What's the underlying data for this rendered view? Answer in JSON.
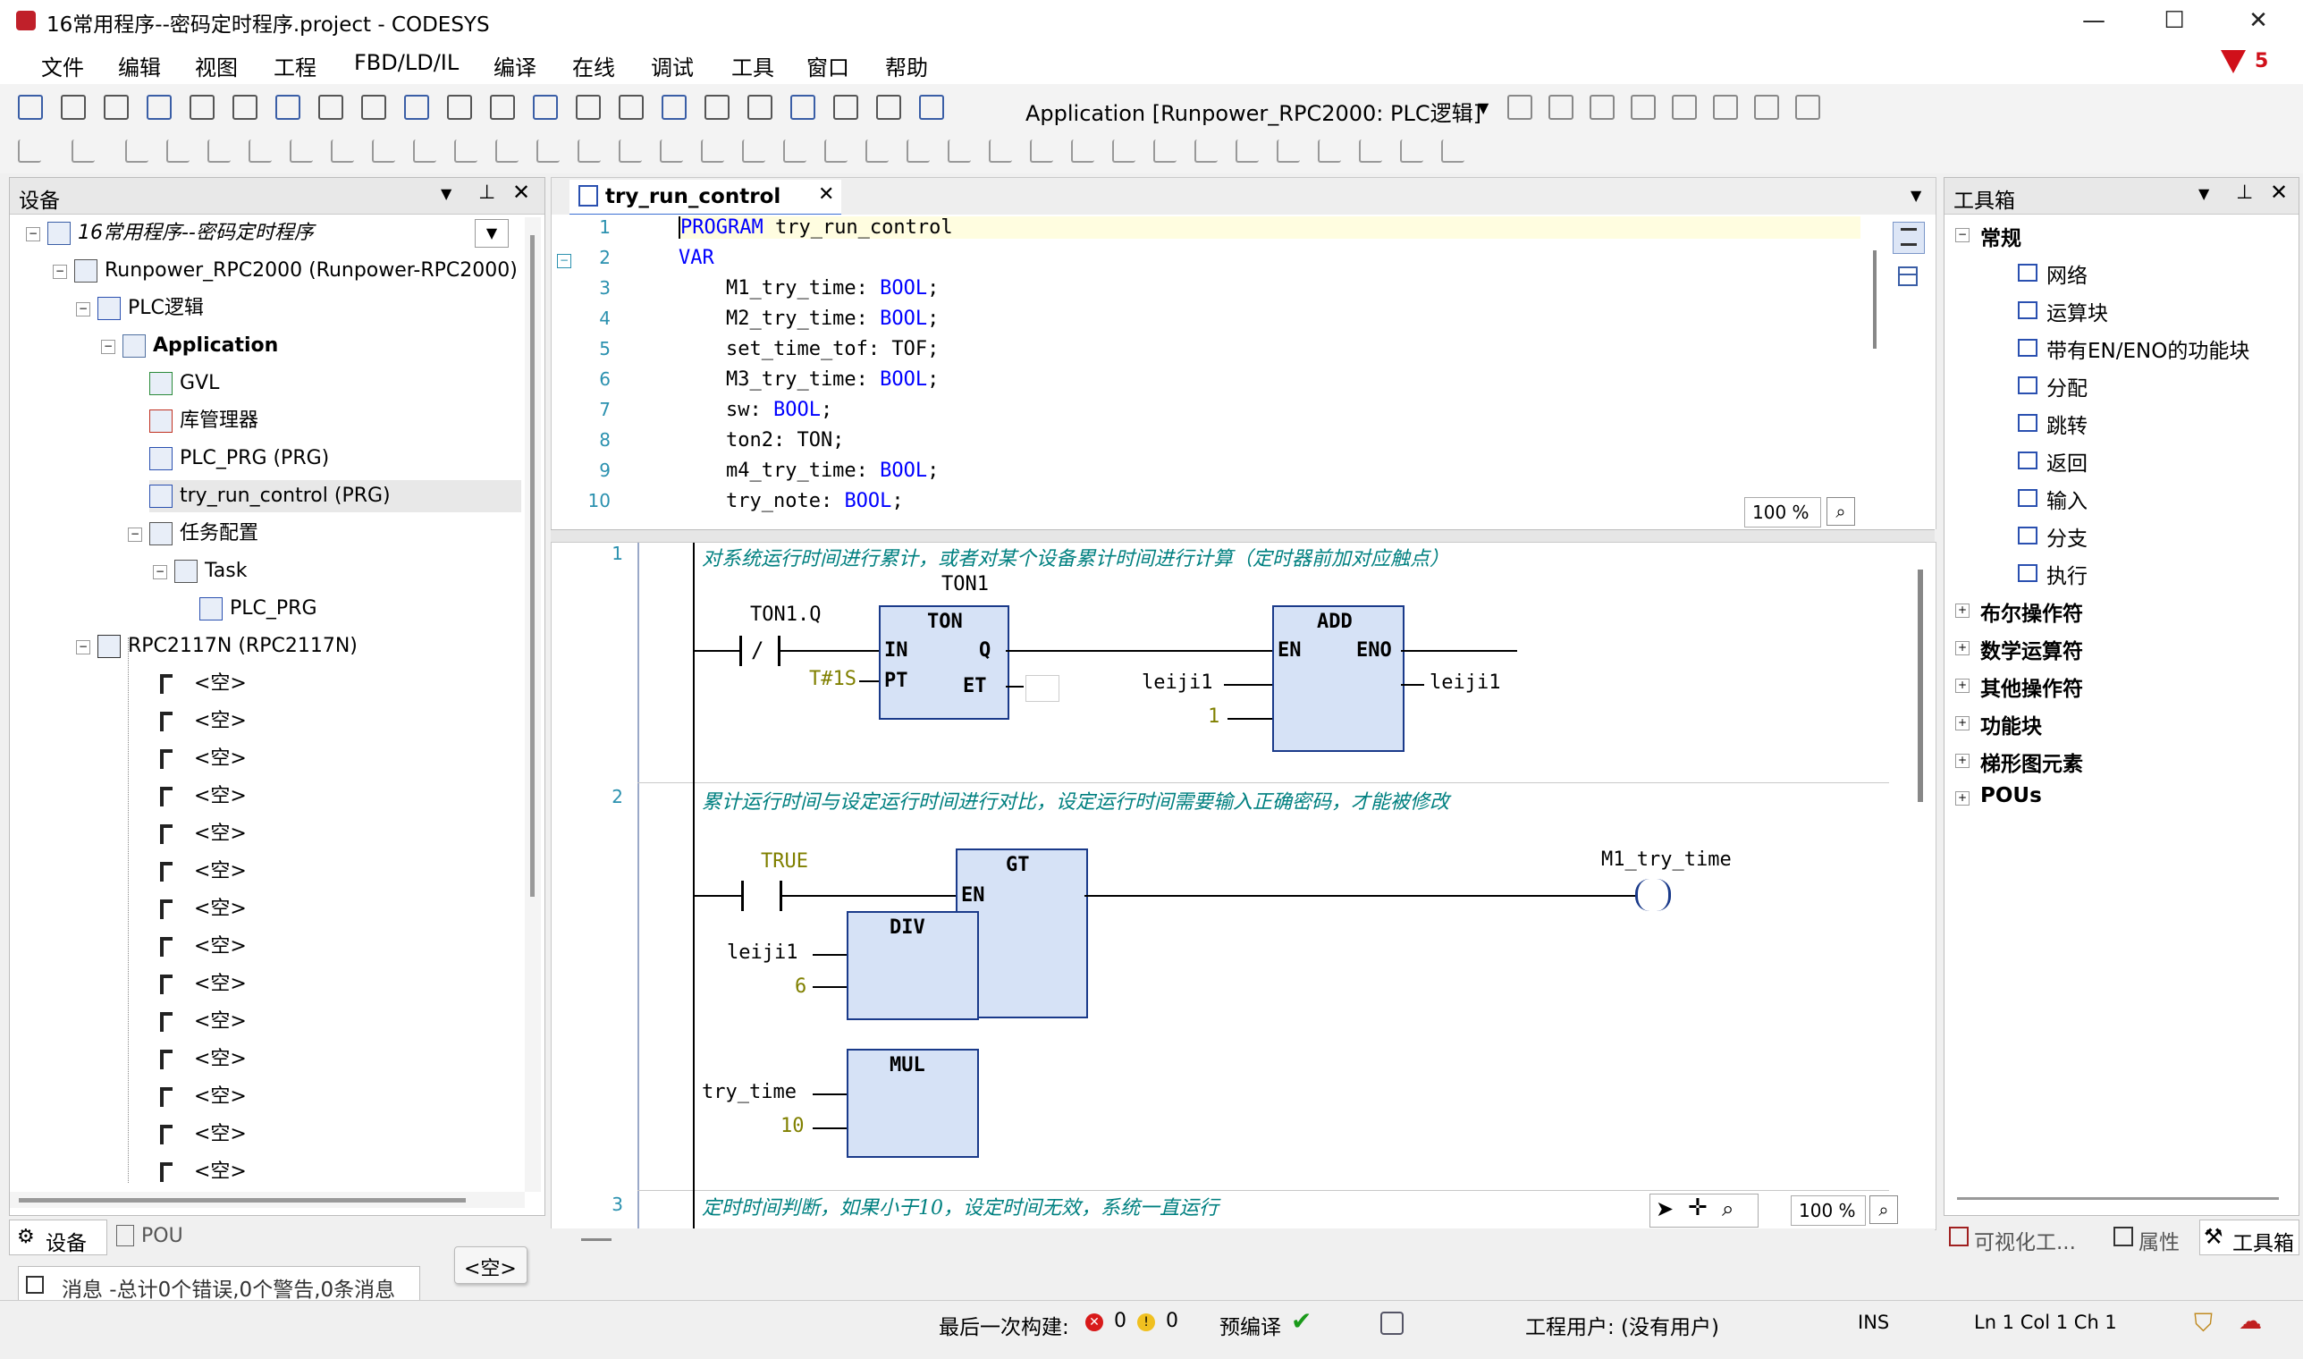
{
  "window": {
    "title": "16常用程序--密码定时程序.project - CODESYS",
    "minimize": "—",
    "maximize": "☐",
    "close": "✕"
  },
  "menu": [
    "文件",
    "编辑",
    "视图",
    "工程",
    "FBD/LD/IL",
    "编译",
    "在线",
    "调试",
    "工具",
    "窗口",
    "帮助"
  ],
  "errors_badge": "5",
  "toolbar": {
    "app_selector": "Application [Runpower_RPC2000: PLC逻辑]"
  },
  "devices_panel": {
    "title": "设备",
    "tree": [
      {
        "label": "16常用程序--密码定时程序",
        "level": 0
      },
      {
        "label": "Runpower_RPC2000 (Runpower-RPC2000)",
        "level": 1
      },
      {
        "label": "PLC逻辑",
        "level": 2
      },
      {
        "label": "Application",
        "level": 3
      },
      {
        "label": "GVL",
        "level": 4
      },
      {
        "label": "库管理器",
        "level": 4
      },
      {
        "label": "PLC_PRG (PRG)",
        "level": 4
      },
      {
        "label": "try_run_control (PRG)",
        "level": 4
      },
      {
        "label": "任务配置",
        "level": 4
      },
      {
        "label": "Task",
        "level": 5
      },
      {
        "label": "PLC_PRG",
        "level": 6
      },
      {
        "label": "RPC2117N (RPC2117N)",
        "level": 2
      }
    ],
    "empty_slot": "<空>",
    "empty_count": 14,
    "tabs": [
      "设备",
      "POU"
    ]
  },
  "editor": {
    "tab": "try_run_control",
    "decl": [
      {
        "n": "1",
        "code": "PROGRAM try_run_control"
      },
      {
        "n": "2",
        "code": "VAR"
      },
      {
        "n": "3",
        "code": "    M1_try_time: BOOL;"
      },
      {
        "n": "4",
        "code": "    M2_try_time: BOOL;"
      },
      {
        "n": "5",
        "code": "    set_time_tof: TOF;"
      },
      {
        "n": "6",
        "code": "    M3_try_time: BOOL;"
      },
      {
        "n": "7",
        "code": "    sw: BOOL;"
      },
      {
        "n": "8",
        "code": "    ton2: TON;"
      },
      {
        "n": "9",
        "code": "    m4_try_time: BOOL;"
      },
      {
        "n": "10",
        "code": "    try_note: BOOL;"
      }
    ],
    "zoom": "100 %",
    "networks": [
      {
        "n": "1",
        "comment": "对系统运行时间进行累计，或者对某个设备累计时间进行计算（定时器前加对应触点）"
      },
      {
        "n": "2",
        "comment": "累计运行时间与设定运行时间进行对比，设定运行时间需要输入正确密码，才能被修改"
      },
      {
        "n": "3",
        "comment": "定时时间判断，如果小于10，设定时间无效，系统一直运行"
      }
    ],
    "net1": {
      "ton_instance": "TON1",
      "ton_title": "TON",
      "in": "IN",
      "pt": "PT",
      "q": "Q",
      "et": "ET",
      "contact": "TON1.Q",
      "pt_val": "T#1S",
      "add_title": "ADD",
      "en": "EN",
      "eno": "ENO",
      "in_var": "leiji1",
      "in_const": "1",
      "out_var": "leiji1"
    },
    "net2": {
      "contact": "TRUE",
      "gt_title": "GT",
      "en": "EN",
      "div_title": "DIV",
      "mul_title": "MUL",
      "div_var": "leiji1",
      "div_const": "6",
      "mul_var": "try_time",
      "mul_const": "10",
      "coil": "M1_try_time"
    }
  },
  "toolbox": {
    "title": "工具箱",
    "groups": [
      {
        "label": "常规",
        "expanded": true,
        "items": [
          "网络",
          "运算块",
          "带有EN/ENO的功能块",
          "分配",
          "跳转",
          "返回",
          "输入",
          "分支",
          "执行"
        ]
      },
      {
        "label": "布尔操作符"
      },
      {
        "label": "数学运算符"
      },
      {
        "label": "其他操作符"
      },
      {
        "label": "功能块"
      },
      {
        "label": "梯形图元素"
      },
      {
        "label": "POUs"
      }
    ],
    "tabs": [
      "可视化工...",
      "属性",
      "工具箱"
    ]
  },
  "messages": {
    "text": "消息 -总计0个错误,0个警告,0条消息",
    "empty_button": "<空>"
  },
  "status": {
    "last_build": "最后一次构建:",
    "errors": "0",
    "warnings": "0",
    "precompile": "预编译",
    "user": "工程用户: (没有用户)",
    "ins": "INS",
    "pos": "Ln 1  Col 1  Ch 1"
  }
}
